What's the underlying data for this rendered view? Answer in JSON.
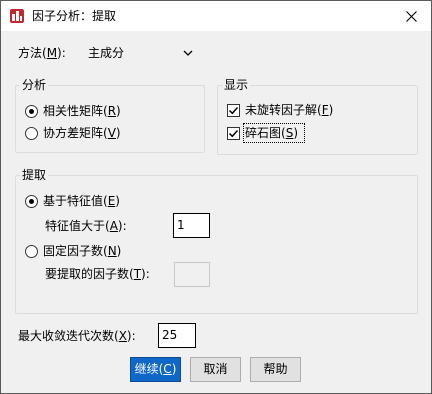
{
  "window": {
    "title": "因子分析：提取",
    "close_glyph": "✕"
  },
  "method": {
    "label_pre": "方法(",
    "label_key": "M",
    "label_post": "):",
    "selected": "主成分"
  },
  "analysis_group": {
    "title": "分析",
    "correlation": {
      "pre": "相关性矩阵(",
      "key": "R",
      "post": ")"
    },
    "covariance": {
      "pre": "协方差矩阵(",
      "key": "V",
      "post": ")"
    }
  },
  "display_group": {
    "title": "显示",
    "unrotated": {
      "pre": "未旋转因子解(",
      "key": "F",
      "post": ")"
    },
    "scree": {
      "pre": "碎石图(",
      "key": "S",
      "post": ")"
    }
  },
  "extract_group": {
    "title": "提取",
    "eigen_based": {
      "pre": "基于特征值(",
      "key": "E",
      "post": ")"
    },
    "eigen_gt": {
      "pre": "特征值大于(",
      "key": "A",
      "post": "):"
    },
    "eigen_value": "1",
    "fixed": {
      "pre": "固定因子数(",
      "key": "N",
      "post": ")"
    },
    "fixed_count": {
      "pre": "要提取的因子数(",
      "key": "T",
      "post": "):"
    },
    "fixed_value": ""
  },
  "max_iter": {
    "pre": "最大收敛迭代次数(",
    "key": "X",
    "post": "):",
    "value": "25"
  },
  "buttons": {
    "continue": {
      "pre": "继续(",
      "key": "C",
      "post": ")"
    },
    "cancel": "取消",
    "help": "帮助"
  }
}
